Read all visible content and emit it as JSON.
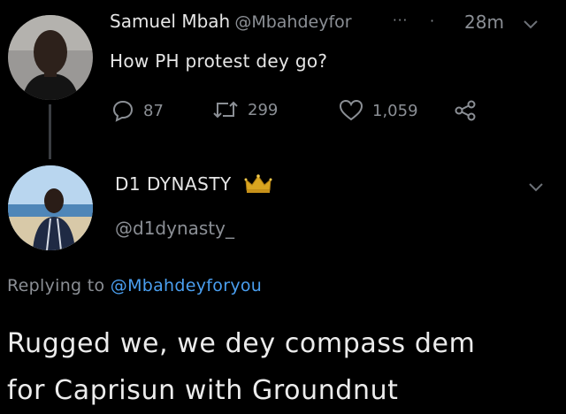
{
  "tweet": {
    "author_name": "Samuel Mbah",
    "author_handle": "@Mbahdeyfor",
    "truncation": "···",
    "separator": "·",
    "time": "28m",
    "text": "How PH protest dey go?",
    "replies": "87",
    "retweets": "299",
    "likes": "1,059"
  },
  "reply": {
    "author_name": "D1 DYNASTY",
    "badge_icon": "crown-icon",
    "author_handle": "@d1dynasty_",
    "replying_prefix": "Replying to",
    "replying_mention": "@Mbahdeyforyou",
    "text_line1": "Rugged we, we dey compass dem",
    "text_line2": "for Caprisun with Groundnut"
  },
  "colors": {
    "background": "#000000",
    "muted": "#8b8f95",
    "link": "#4a9ff0",
    "crown": "#d9a520"
  }
}
